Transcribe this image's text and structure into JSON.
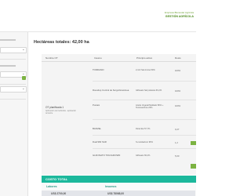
{
  "brand": {
    "line1": "Empresa Bienestar Agrícola",
    "line2": "GESTIÓN AGRÍCOLA"
  },
  "main": {
    "title": "Hectáreas totales: 42,00 ha",
    "table": {
      "headers": [
        "Nombre OT",
        "Insumo",
        "Principio activo",
        "Dosis"
      ],
      "group": {
        "name": "OT planificada 1",
        "sub": "Aplicación de herbicida - aplicación terrestre"
      },
      "rows": [
        {
          "insumo": "TORDASIO",
          "pa": "2,4-D Sal Amina 50%",
          "dosis": "100%"
        },
        {
          "insumo": "Roundup Control de Sorgo/Graminea",
          "pa": "Glifosato Sal potásica 66,2%",
          "dosis": "100%"
        },
        {
          "insumo": "Pucará",
          "pa": "Aceite Vegetal Metilado 80% + Tensioactivos 20%",
          "dosis": "100%"
        },
        {
          "insumo": "BANVEL",
          "pa": "Dicamba 57,7%",
          "dosis": "0,27"
        },
        {
          "insumo": "Dual 960 SAR",
          "pa": "S-metolacloro 96%",
          "dosis": "1,2"
        },
        {
          "insumo": "GLIFOSATO TOUCHDOWN",
          "pa": "Glifosato 66,2%",
          "dosis": "5,00"
        }
      ]
    },
    "costo": {
      "label": "COSTO TOTAL",
      "labores_label": "Labores",
      "labores_value": "US$ 2700,00",
      "insumos_label": "Insumos",
      "insumos_value": "US$ 78068,00"
    }
  },
  "colors": {
    "teal": "#1cb89c",
    "green": "#7cb342",
    "brand_green": "#4c8a1a"
  }
}
